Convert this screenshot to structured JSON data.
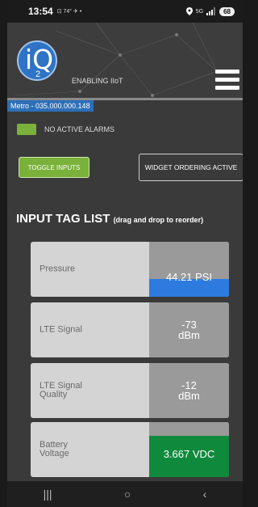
{
  "status_bar": {
    "time": "13:54",
    "left_indicators": "⊡ 74° ✈ •",
    "network": "5G",
    "battery": "68"
  },
  "header": {
    "logo_text": "iQ",
    "logo_sub": "2",
    "tagline": "ENABLING IIoT"
  },
  "device": {
    "label": "Metro - 035.000.000.148"
  },
  "alarm": {
    "text": "NO ACTIVE ALARMS"
  },
  "buttons": {
    "toggle_inputs": "TOGGLE INPUTS",
    "widget_ordering": "WIDGET ORDERING ACTIVE"
  },
  "list": {
    "title": "INPUT TAG LIST",
    "hint": "(drag and drop to reorder)",
    "tags": [
      {
        "name": "Pressure",
        "value": "44.21 PSI",
        "fill_color": "#2e7be0",
        "fill_fraction": 0.32
      },
      {
        "name": "LTE Signal",
        "value": "-73\ndBm",
        "fill_color": "#9a9a9a",
        "fill_fraction": 0
      },
      {
        "name": "LTE Signal\nQuality",
        "value": "-12\ndBm",
        "fill_color": "#9a9a9a",
        "fill_fraction": 0
      },
      {
        "name": "Battery\nVoltage",
        "value": "3.667 VDC",
        "fill_color": "#0f8a3c",
        "fill_fraction": 0.75
      }
    ]
  },
  "navbar": {
    "recents": "|||",
    "home": "○",
    "back": "‹"
  }
}
